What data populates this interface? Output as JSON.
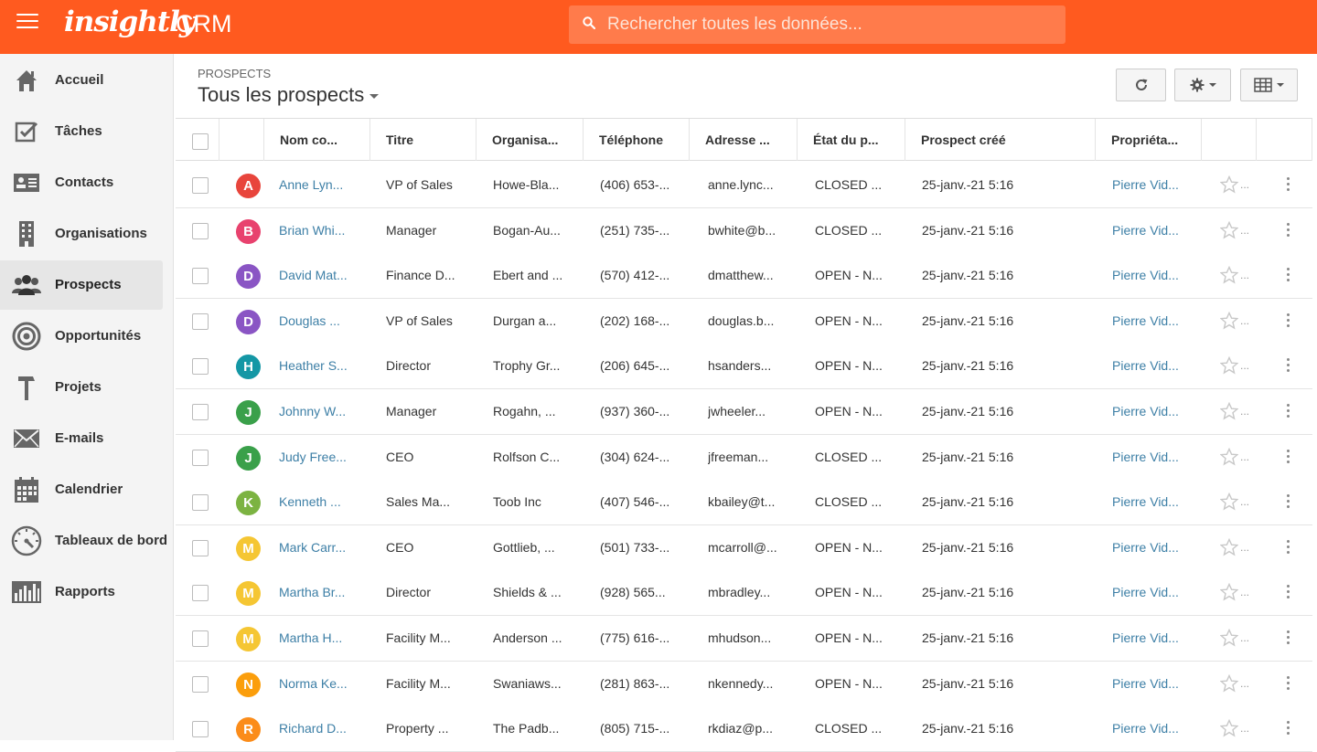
{
  "app": {
    "logo": "insightly",
    "product": "CRM",
    "accent_color": "#ff5a1f"
  },
  "search": {
    "placeholder": "Rechercher toutes les données..."
  },
  "sidebar": {
    "items": [
      {
        "label": "Accueil",
        "icon": "home-icon",
        "active": false
      },
      {
        "label": "Tâches",
        "icon": "tasks-checkbox-icon",
        "active": false
      },
      {
        "label": "Contacts",
        "icon": "contact-card-icon",
        "active": false
      },
      {
        "label": "Organisations",
        "icon": "building-icon",
        "active": false
      },
      {
        "label": "Prospects",
        "icon": "people-icon",
        "active": true
      },
      {
        "label": "Opportunités",
        "icon": "target-icon",
        "active": false
      },
      {
        "label": "Projets",
        "icon": "hammer-icon",
        "active": false
      },
      {
        "label": "E-mails",
        "icon": "envelope-icon",
        "active": false
      },
      {
        "label": "Calendrier",
        "icon": "calendar-icon",
        "active": false
      },
      {
        "label": "Tableaux de bord",
        "icon": "gauge-icon",
        "active": false
      },
      {
        "label": "Rapports",
        "icon": "bar-chart-icon",
        "active": false
      }
    ]
  },
  "header": {
    "breadcrumb": "PROSPECTS",
    "view_title": "Tous les prospects"
  },
  "toolbar": {
    "refresh_icon": "refresh-icon",
    "settings_icon": "gear-icon",
    "columns_icon": "grid-icon"
  },
  "table": {
    "columns": [
      "Nom co...",
      "Titre",
      "Organisa...",
      "Téléphone",
      "Adresse ...",
      "État du p...",
      "Prospect créé",
      "Propriéta..."
    ],
    "rows": [
      {
        "initial": "A",
        "color": "#e8453c",
        "name": "Anne Lyn...",
        "title": "VP of Sales",
        "org": "Howe-Bla...",
        "phone": "(406) 653-...",
        "email": "anne.lync...",
        "status": "CLOSED ...",
        "created": "25-janv.-21 5:16",
        "owner": "Pierre Vid..."
      },
      {
        "initial": "B",
        "color": "#e8426e",
        "name": "Brian Whi...",
        "title": "Manager",
        "org": "Bogan-Au...",
        "phone": "(251) 735-...",
        "email": "bwhite@b...",
        "status": "CLOSED ...",
        "created": "25-janv.-21 5:16",
        "owner": "Pierre Vid..."
      },
      {
        "initial": "D",
        "color": "#8a55c4",
        "name": "David Mat...",
        "title": "Finance D...",
        "org": "Ebert and ...",
        "phone": "(570) 412-...",
        "email": "dmatthew...",
        "status": "OPEN - N...",
        "created": "25-janv.-21 5:16",
        "owner": "Pierre Vid..."
      },
      {
        "initial": "D",
        "color": "#8a55c4",
        "name": "Douglas ...",
        "title": "VP of Sales",
        "org": "Durgan a...",
        "phone": "(202) 168-...",
        "email": "douglas.b...",
        "status": "OPEN - N...",
        "created": "25-janv.-21 5:16",
        "owner": "Pierre Vid..."
      },
      {
        "initial": "H",
        "color": "#1497a5",
        "name": "Heather S...",
        "title": "Director",
        "org": "Trophy Gr...",
        "phone": "(206) 645-...",
        "email": "hsanders...",
        "status": "OPEN - N...",
        "created": "25-janv.-21 5:16",
        "owner": "Pierre Vid..."
      },
      {
        "initial": "J",
        "color": "#3aa04a",
        "name": "Johnny W...",
        "title": "Manager",
        "org": "Rogahn, ...",
        "phone": "(937) 360-...",
        "email": "jwheeler...",
        "status": "OPEN - N...",
        "created": "25-janv.-21 5:16",
        "owner": "Pierre Vid..."
      },
      {
        "initial": "J",
        "color": "#3aa04a",
        "name": "Judy Free...",
        "title": "CEO",
        "org": "Rolfson C...",
        "phone": "(304) 624-...",
        "email": "jfreeman...",
        "status": "CLOSED ...",
        "created": "25-janv.-21 5:16",
        "owner": "Pierre Vid..."
      },
      {
        "initial": "K",
        "color": "#7cb342",
        "name": "Kenneth ...",
        "title": "Sales Ma...",
        "org": "Toob Inc",
        "phone": "(407) 546-...",
        "email": "kbailey@t...",
        "status": "CLOSED ...",
        "created": "25-janv.-21 5:16",
        "owner": "Pierre Vid..."
      },
      {
        "initial": "M",
        "color": "#f5c633",
        "name": "Mark Carr...",
        "title": "CEO",
        "org": "Gottlieb, ...",
        "phone": "(501) 733-...",
        "email": "mcarroll@...",
        "status": "OPEN - N...",
        "created": "25-janv.-21 5:16",
        "owner": "Pierre Vid..."
      },
      {
        "initial": "M",
        "color": "#f5c633",
        "name": "Martha Br...",
        "title": "Director",
        "org": "Shields & ...",
        "phone": "(928) 565...",
        "email": "mbradley...",
        "status": "OPEN - N...",
        "created": "25-janv.-21 5:16",
        "owner": "Pierre Vid..."
      },
      {
        "initial": "M",
        "color": "#f5c633",
        "name": "Martha H...",
        "title": "Facility M...",
        "org": "Anderson ...",
        "phone": "(775) 616-...",
        "email": "mhudson...",
        "status": "OPEN - N...",
        "created": "25-janv.-21 5:16",
        "owner": "Pierre Vid..."
      },
      {
        "initial": "N",
        "color": "#fb9e0c",
        "name": "Norma Ke...",
        "title": "Facility M...",
        "org": "Swaniaws...",
        "phone": "(281) 863-...",
        "email": "nkennedy...",
        "status": "OPEN - N...",
        "created": "25-janv.-21 5:16",
        "owner": "Pierre Vid..."
      },
      {
        "initial": "R",
        "color": "#fb8c1a",
        "name": "Richard D...",
        "title": "Property ...",
        "org": "The Padb...",
        "phone": "(805) 715-...",
        "email": "rkdiaz@p...",
        "status": "CLOSED ...",
        "created": "25-janv.-21 5:16",
        "owner": "Pierre Vid..."
      }
    ],
    "star_suffix": "..."
  }
}
